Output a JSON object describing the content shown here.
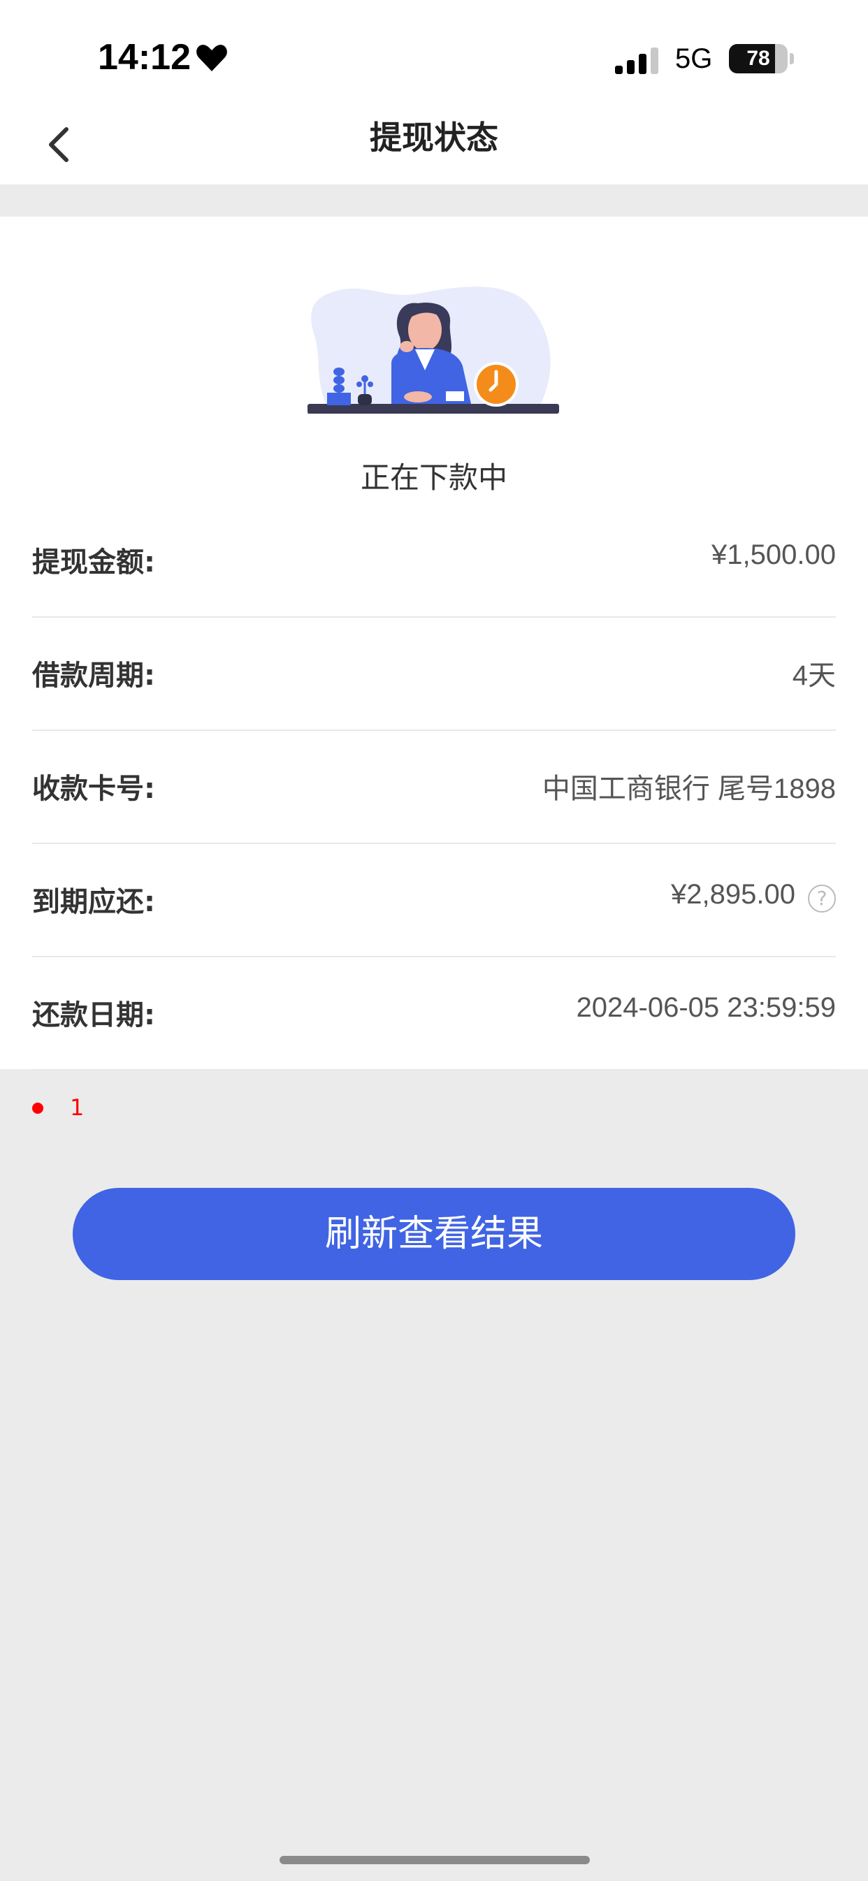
{
  "status_bar": {
    "time": "14:12",
    "network": "5G",
    "battery": "78",
    "battery_level": 0.78
  },
  "nav": {
    "title": "提现状态"
  },
  "status": {
    "text": "正在下款中"
  },
  "details": [
    {
      "label": "提现金额:",
      "value": "¥1,500.00"
    },
    {
      "label": "借款周期:",
      "value": "4天"
    },
    {
      "label": "收款卡号:",
      "value": "中国工商银行 尾号1898"
    },
    {
      "label": "到期应还:",
      "value": "¥2,895.00",
      "help": "?"
    },
    {
      "label": "还款日期:",
      "value": "2024-06-05 23:59:59"
    }
  ],
  "note": {
    "text": "1",
    "color": "#ff0000"
  },
  "button": {
    "label": "刷新查看结果",
    "color": "#4064e3"
  },
  "icons": [
    "heart-icon",
    "signal-icon",
    "battery-icon",
    "back-chevron-icon",
    "waiting-illustration",
    "help-icon"
  ]
}
